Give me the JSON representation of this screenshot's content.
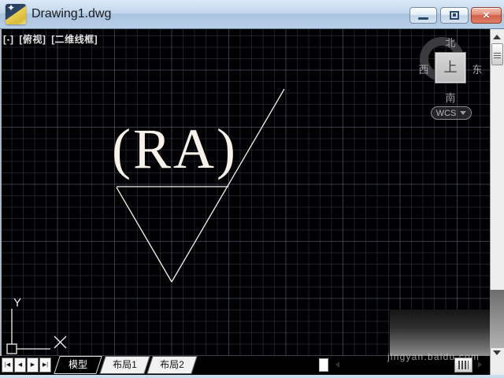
{
  "window": {
    "title": "Drawing1.dwg",
    "close_glyph": "×"
  },
  "viewport_controls": {
    "menu": "[-]",
    "view": "[俯视]",
    "visual_style": "[二维线框]"
  },
  "viewcube": {
    "north": "北",
    "south": "南",
    "west": "西",
    "east": "东",
    "face_label": "上",
    "wcs_label": "WCS"
  },
  "drawing": {
    "annotation": "(RA)",
    "ucs_x": "X",
    "ucs_y": "Y"
  },
  "tab_bar": {
    "nav": {
      "first": "|◀",
      "prev": "◀",
      "next": "▶",
      "last": "▶|"
    },
    "tabs": [
      {
        "label": "模型",
        "active": true
      },
      {
        "label": "布局1",
        "active": false
      },
      {
        "label": "布局2",
        "active": false
      }
    ]
  },
  "watermark": {
    "text": "jingyan.baidu.com"
  },
  "colors": {
    "canvas_bg": "#010103",
    "grid_minor": "#2c303a",
    "grid_major": "#525868",
    "geometry": "#f5f1e8",
    "titlebar": "#c2d7ec",
    "close_button": "#d2604a",
    "viewcube_ring": "#3b3b3f"
  }
}
